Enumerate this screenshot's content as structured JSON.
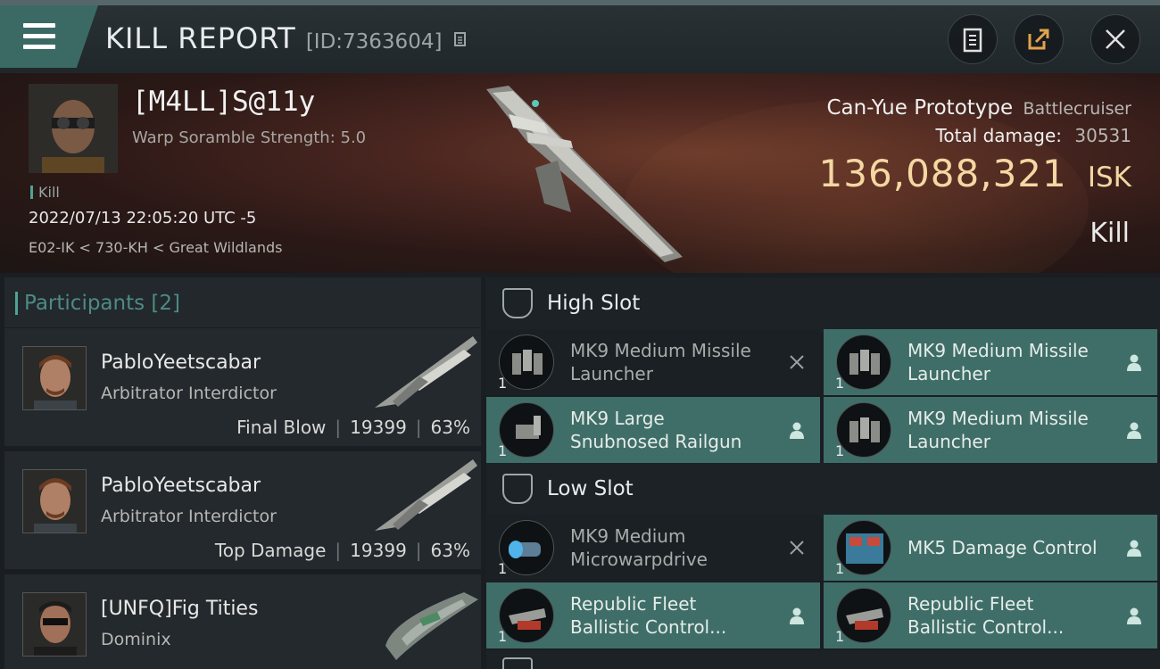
{
  "header": {
    "title": "KILL REPORT",
    "report_id": "[ID:7363604]",
    "icons": [
      "menu-icon",
      "clipboard-icon",
      "share-icon",
      "close-icon"
    ]
  },
  "victim": {
    "name": "[M4LL]S@11y",
    "scramble": "Warp Soramble Strength: 5.0",
    "kill_tag": "Kill",
    "datetime": "2022/07/13 22:05:20 UTC -5",
    "location": "E02-IK < 730-KH < Great Wildlands"
  },
  "ship": {
    "name": "Can-Yue Prototype",
    "class": "Battlecruiser",
    "damage_label": "Total damage:",
    "damage_value": "30531",
    "isk_value": "136,088,321",
    "isk_unit": "ISK",
    "result": "Kill"
  },
  "participants": {
    "header": "Participants",
    "count": "[2]",
    "items": [
      {
        "name": "PabloYeetscabar",
        "ship": "Arbitrator Interdictor",
        "role": "Final Blow",
        "damage": "19399",
        "percent": "63%"
      },
      {
        "name": "PabloYeetscabar",
        "ship": "Arbitrator Interdictor",
        "role": "Top Damage",
        "damage": "19399",
        "percent": "63%"
      },
      {
        "name": "[UNFQ]Fig Tities",
        "ship": "Dominix",
        "role": "",
        "damage": "",
        "percent": ""
      }
    ]
  },
  "slots": {
    "high": {
      "label": "High Slot",
      "modules": [
        {
          "name": "MK9 Medium Missile Launcher",
          "line1": "MK9 Medium Missile",
          "line2": "Launcher",
          "qty": "1",
          "status": "destroyed"
        },
        {
          "name": "MK9 Medium Missile Launcher",
          "line1": "MK9 Medium Missile",
          "line2": "Launcher",
          "qty": "1",
          "status": "dropped"
        },
        {
          "name": "MK9 Large Snubnosed Railgun",
          "line1": "MK9 Large",
          "line2": "Snubnosed Railgun",
          "qty": "1",
          "status": "dropped"
        },
        {
          "name": "MK9 Medium Missile Launcher",
          "line1": "MK9 Medium Missile",
          "line2": "Launcher",
          "qty": "1",
          "status": "dropped"
        }
      ]
    },
    "low": {
      "label": "Low Slot",
      "modules": [
        {
          "name": "MK9 Medium Microwarpdrive",
          "line1": "MK9 Medium",
          "line2": "Microwarpdrive",
          "qty": "1",
          "status": "destroyed"
        },
        {
          "name": "MK5 Damage Control",
          "line1": "MK5 Damage Control",
          "line2": "",
          "qty": "1",
          "status": "dropped"
        },
        {
          "name": "Republic Fleet Ballistic Control...",
          "line1": "Republic Fleet",
          "line2": "Ballistic Control...",
          "qty": "1",
          "status": "dropped"
        },
        {
          "name": "Republic Fleet Ballistic Control...",
          "line1": "Republic Fleet",
          "line2": "Ballistic Control...",
          "qty": "1",
          "status": "dropped"
        }
      ]
    }
  },
  "colors": {
    "accent": "#4fa397",
    "isk": "#f4d7a2",
    "module_dropped": "#3f6e68",
    "module_destroyed": "#1a2024"
  }
}
